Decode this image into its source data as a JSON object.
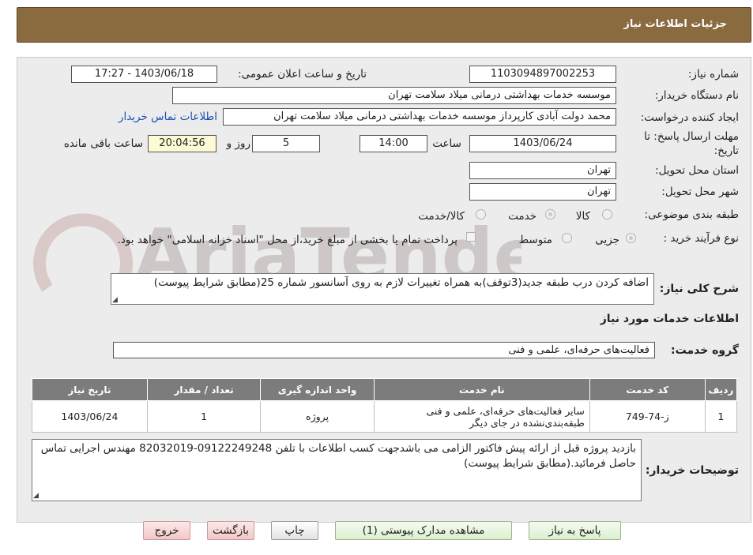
{
  "header": {
    "title": "جزئیات اطلاعات نیاز"
  },
  "watermark": {
    "text": "AriaTender.neT"
  },
  "form": {
    "need_number_label": "شماره نیاز:",
    "need_number": "1103094897002253",
    "announce_label": "تاریخ و ساعت اعلان عمومی:",
    "announce_value": "1403/06/18 - 17:27",
    "buyer_org_label": "نام دستگاه خریدار:",
    "buyer_org": "موسسه خدمات بهداشتی درمانی میلاد سلامت تهران",
    "creator_label": "ایجاد کننده درخواست:",
    "creator": "محمد دولت آبادی کارپرداز موسسه خدمات بهداشتی درمانی میلاد سلامت تهران",
    "contact_link": "اطلاعات تماس خریدار",
    "deadline_label_1": "مهلت ارسال پاسخ: تا",
    "deadline_label_2": "تاریخ:",
    "deadline_date": "1403/06/24",
    "time_label": "ساعت",
    "deadline_time": "14:00",
    "days_value": "5",
    "days_label": "روز و",
    "remaining_time": "20:04:56",
    "remaining_label": "ساعت باقی مانده",
    "province_label": "استان محل تحویل:",
    "province": "تهران",
    "city_label": "شهر محل تحویل:",
    "city": "تهران",
    "category_label": "طبقه بندی موضوعی:",
    "category_options": [
      "کالا",
      "خدمت",
      "کالا/خدمت"
    ],
    "process_label": "نوع فرآیند خرید :",
    "process_options": [
      "جزیی",
      "متوسط"
    ],
    "payment_note": "پرداخت تمام یا بخشی از مبلغ خرید،از محل \"اسناد خزانه اسلامی\" خواهد بود.",
    "description_label": "شرح کلی نیاز:",
    "description": "اضافه کردن درب طبقه جدید(3توقف)به همراه تغییرات لازم به روی آسانسور شماره 25(مطابق شرایط پیوست)"
  },
  "services": {
    "section_title": "اطلاعات خدمات مورد نیاز",
    "group_label": "گروه خدمت:",
    "group_value": "فعالیت‌های حرفه‌ای، علمی و فنی",
    "columns": [
      "ردیف",
      "کد خدمت",
      "نام خدمت",
      "واحد اندازه گیری",
      "تعداد / مقدار",
      "تاریخ نیاز"
    ],
    "rows": [
      {
        "index": "1",
        "code": "ز-74-749",
        "name": "سایر فعالیت‌های حرفه‌ای، علمی و فنی طبقه‌بندی‌نشده در جای دیگر",
        "unit": "پروژه",
        "qty": "1",
        "date": "1403/06/24"
      }
    ]
  },
  "buyer_notes": {
    "label": "توضیحات خریدار:",
    "text": "بازدید پروژه قبل از ارائه پیش فاکتور الزامی می باشدجهت کسب اطلاعات با تلفن 09122249248-82032019 مهندس اجرایی تماس حاصل فرمائید.(مطابق شرایط پیوست)"
  },
  "buttons": {
    "reply": "پاسخ به نیاز",
    "attachments": "مشاهده مدارک پیوستی (1)",
    "print": "چاپ",
    "back": "بازگشت",
    "exit": "خروج"
  }
}
